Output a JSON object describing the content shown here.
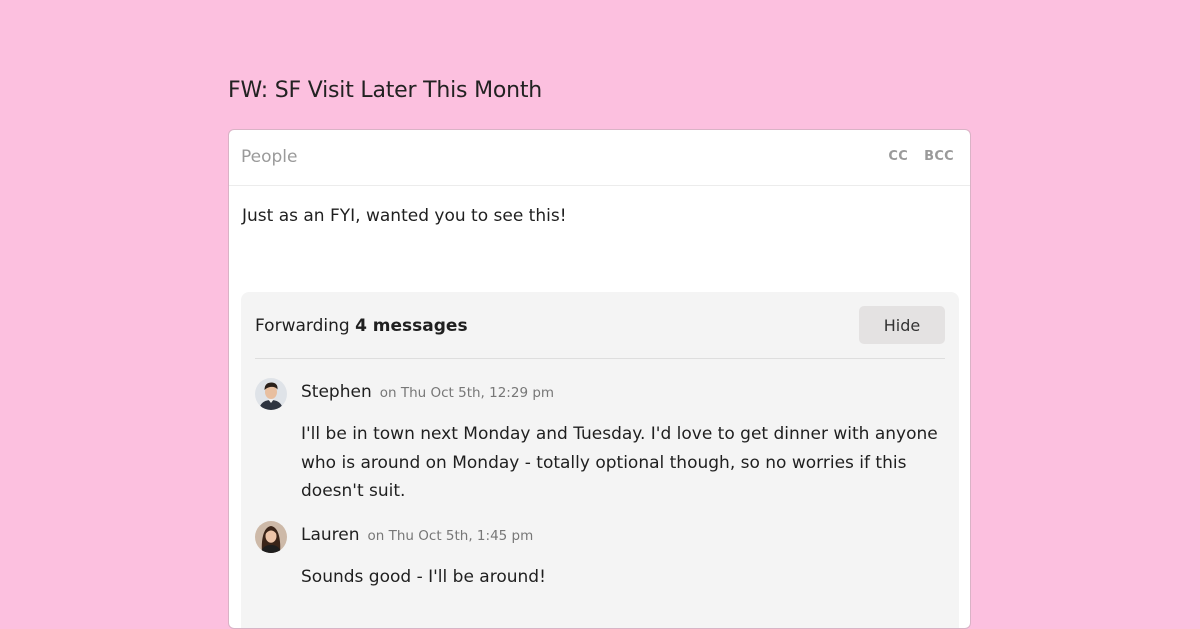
{
  "subject": "FW: SF Visit Later This Month",
  "recipients": {
    "placeholder": "People",
    "cc_label": "CC",
    "bcc_label": "BCC"
  },
  "body": "Just as an FYI, wanted you to see this!",
  "forwarding": {
    "prefix": "Forwarding",
    "count_label": "4 messages",
    "hide_label": "Hide"
  },
  "messages": [
    {
      "sender": "Stephen",
      "timestamp": "on Thu Oct 5th, 12:29 pm",
      "text": "I'll be in town next Monday and Tuesday. I'd love to get dinner with anyone who is around on Monday - totally optional though, so no worries if this doesn't suit."
    },
    {
      "sender": "Lauren",
      "timestamp": "on Thu Oct 5th, 1:45 pm",
      "text": "Sounds good - I'll be around!"
    }
  ],
  "colors": {
    "background": "#fcc0df",
    "card": "#ffffff",
    "forward_box": "#f4f4f4",
    "hide_button": "#e4e2e2"
  }
}
